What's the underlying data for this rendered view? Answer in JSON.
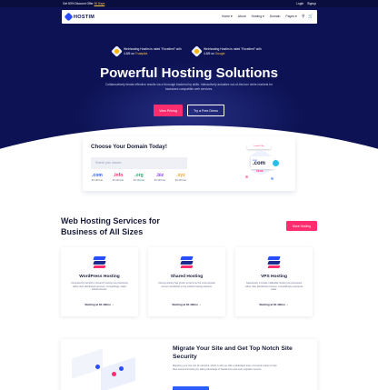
{
  "topbar": {
    "promo_text": "Get 50% Discount Offer",
    "promo_highlight": "26 Days",
    "links": [
      "Login",
      "Signup"
    ]
  },
  "nav": {
    "brand": "HOSTIM",
    "menu": [
      "Home ▾",
      "About",
      "Hosting ▾",
      "Domain",
      "Pages ▾"
    ],
    "icons": [
      "search-icon",
      "cart-icon"
    ]
  },
  "hero": {
    "awards": [
      {
        "text": "Webhosting Hostim is rated \"Excellent\" with 4.8/5 on",
        "brand": "Trustpilot"
      },
      {
        "text": "Webhosting Hostim is rated \"Excellent\" with 4.8/5 on",
        "brand": "Google"
      }
    ],
    "title": "Powerful Hosting Solutions",
    "subtitle": "Collaboratively iterate effective results via a thorough backend by skills. Interactively actualize out-of-the-box niche markets for backward-compatible web services.",
    "primary_button": "View Pricing",
    "secondary_button": "Try a Free Demo"
  },
  "domain": {
    "title": "Choose Your Domain Today!",
    "search_placeholder": "Search your domain",
    "search_button": "Search",
    "tlds": [
      {
        "ext": ".com",
        "price": "$3.49/Year",
        "color": "#2a5cff"
      },
      {
        "ext": ".info",
        "price": "$3.49/Year",
        "color": "#ff2d6f"
      },
      {
        "ext": ".org",
        "price": "$3.49/Year",
        "color": "#22b573"
      },
      {
        "ext": ".biz",
        "price": "$3.49/Year",
        "color": "#8e44ff"
      },
      {
        "ext": ".xyz",
        "price": "$4.99/Year",
        "color": "#ff9f1c"
      }
    ],
    "promo": {
      "tag": "Limited Offer",
      "price_label": "Just",
      "ext": ".com",
      "price": "16.99"
    }
  },
  "services": {
    "title": "Web Hosting Services for Business of All Sizes",
    "more_button": "More Hosting",
    "cards": [
      {
        "name": "WordPress Hosting",
        "desc": "Competently transform dynamic hosting via proactively rather than distributed services. Compellingly matrix infrastructures.",
        "start": "Starting at $1.49/mo →"
      },
      {
        "name": "Shared Hosting",
        "desc": "Caring Hosting has grown to become the most popular servers worldwide in the market hosting features.",
        "start": "Starting at $1.49/mo →"
      },
      {
        "name": "VPS Hosting",
        "desc": "Seamlessly innovate malleable hosting via processes rather than distributed process. Compellingly repurpose value.",
        "start": "Starting at $1.49/mo →"
      }
    ]
  },
  "migrate": {
    "title": "Migrate Your Site and Get Top Notch Site Security",
    "desc": "Migrating your site can be stressful, which is why we offer a dedicated team of experts ready to help. Rest assured knowing by taking advantage of hassle-free and easy migration service."
  },
  "colors": {
    "navy": "#0d1254",
    "accent": "#ff2d6f",
    "primary": "#2a5cff"
  }
}
